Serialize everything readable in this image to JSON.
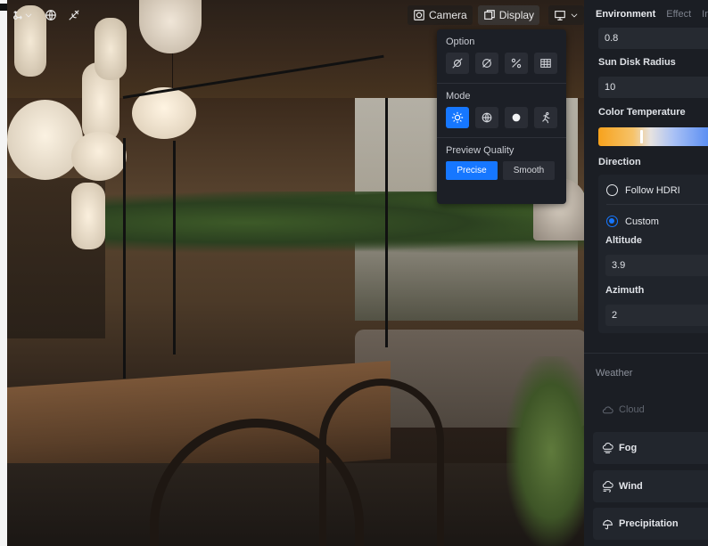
{
  "toolbar": {
    "left_icons": [
      "transform-icon",
      "globe-icon",
      "no-light-icon"
    ],
    "camera_label": "Camera",
    "display_label": "Display",
    "extra_icon": "screen-settings-icon"
  },
  "display_popup": {
    "option_title": "Option",
    "option_icons": [
      "no-render-icon",
      "slash-circle-icon",
      "percent-icon",
      "grid-icon"
    ],
    "mode_title": "Mode",
    "mode_icons": [
      "sun-icon",
      "globe-icon",
      "solid-circle-icon",
      "run-icon"
    ],
    "active_mode": "sun-icon",
    "quality_title": "Preview Quality",
    "quality_options": [
      "Precise",
      "Smooth"
    ],
    "active_quality": "Precise"
  },
  "panel": {
    "tabs": [
      "Environment",
      "Effect",
      "In"
    ],
    "active_tab": "Environment",
    "top_value": "0.8",
    "sun_disk_radius_label": "Sun Disk Radius",
    "sun_disk_radius_value": "10",
    "color_temperature_label": "Color Temperature",
    "color_temperature_level": 0.36,
    "direction_label": "Direction",
    "follow_hdri_label": "Follow HDRI",
    "custom_label": "Custom",
    "altitude_label": "Altitude",
    "altitude_value": "3.9",
    "azimuth_label": "Azimuth",
    "azimuth_value": "2",
    "weather_title": "Weather",
    "weather_items": [
      {
        "label": "Cloud",
        "icon": "cloud-icon",
        "enabled": false
      },
      {
        "label": "Fog",
        "icon": "fog-icon",
        "enabled": true
      },
      {
        "label": "Wind",
        "icon": "wind-icon",
        "enabled": true
      },
      {
        "label": "Precipitation",
        "icon": "umbrella-icon",
        "enabled": true
      }
    ]
  },
  "colors": {
    "accent": "#1677ff",
    "panel_bg": "#1b1e24"
  }
}
